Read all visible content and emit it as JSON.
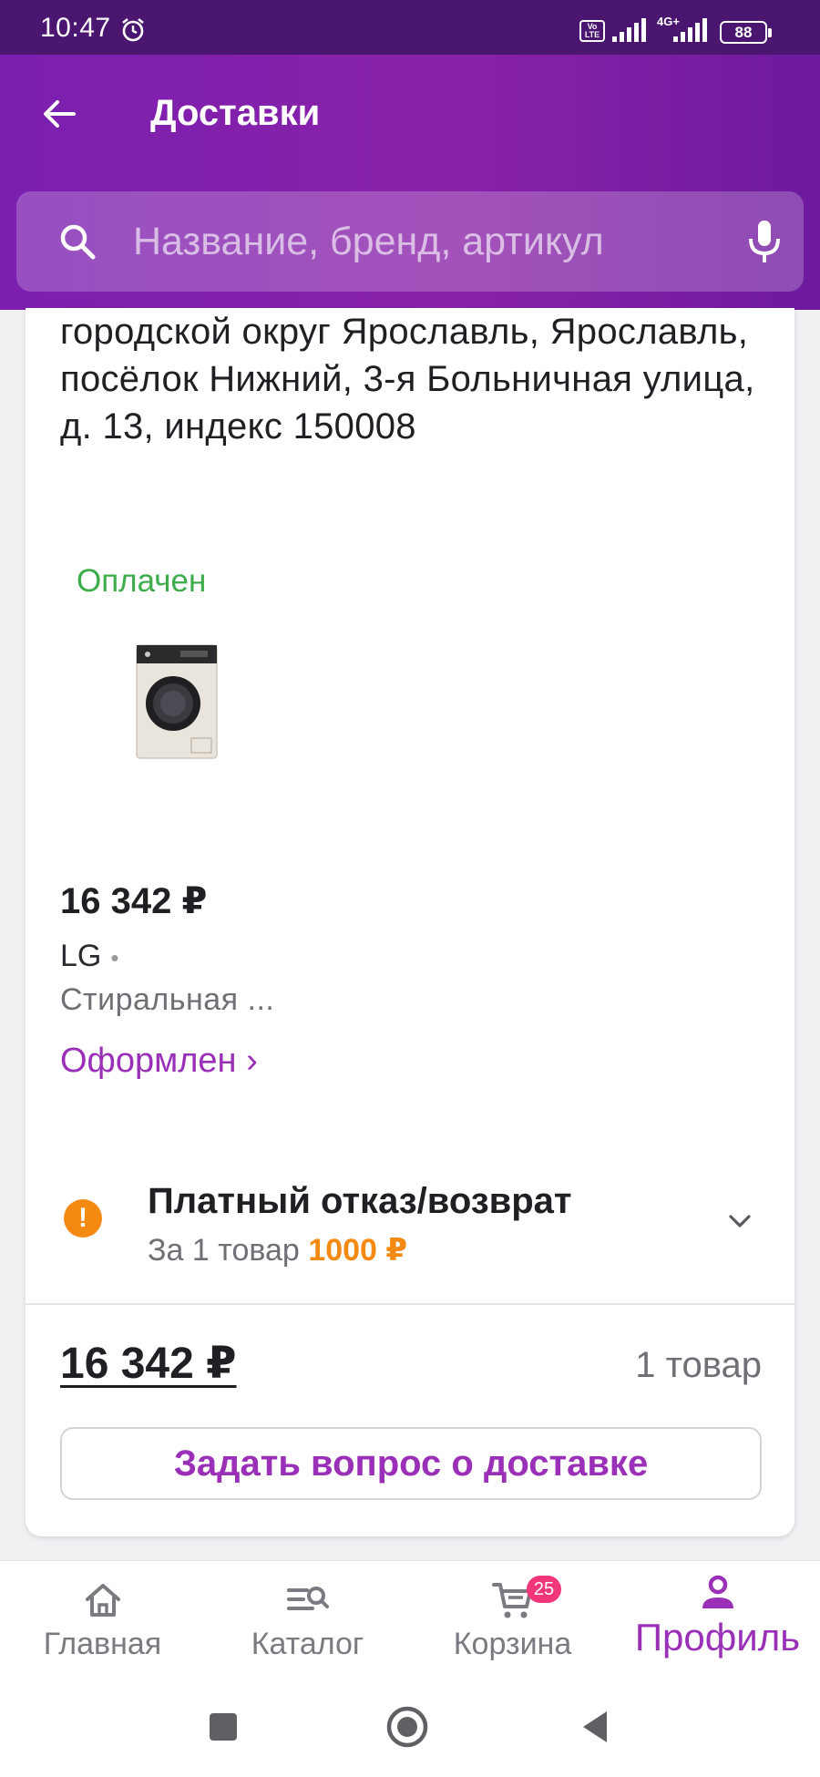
{
  "status_bar": {
    "time": "10:47",
    "network": "4G+",
    "volte": "Vo LTE",
    "battery": "88"
  },
  "header": {
    "title": "Доставки",
    "search_placeholder": "Название, бренд, артикул"
  },
  "delivery": {
    "address": "городской округ Ярославль, Ярославль, посёлок Нижний, 3-я Больничная улица, д. 13, индекс 150008",
    "payment_status": "Оплачен",
    "product": {
      "price": "16 342 ₽",
      "brand": "LG",
      "brand_separator": "•",
      "name": "Стиральная ..."
    },
    "order_status": "Оформлен ›",
    "refund": {
      "title": "Платный отказ/возврат",
      "subtitle": "За 1 товар",
      "fee": "1000 ₽"
    },
    "total": "16 342 ₽",
    "items_count": "1 товар",
    "ask_button": "Задать вопрос о доставке"
  },
  "bottom_nav": {
    "items": [
      {
        "label": "Главная",
        "icon": "home-icon"
      },
      {
        "label": "Каталог",
        "icon": "catalog-search-icon"
      },
      {
        "label": "Корзина",
        "icon": "cart-icon",
        "badge": "25"
      },
      {
        "label": "Профиль",
        "icon": "profile-icon",
        "active": true
      }
    ]
  },
  "colors": {
    "header": "#7a1fb0",
    "status_bar": "#4a1670",
    "accent": "#9a2fb8",
    "paid": "#3dac4b",
    "warning": "#f58a12",
    "badge": "#f2367a"
  }
}
